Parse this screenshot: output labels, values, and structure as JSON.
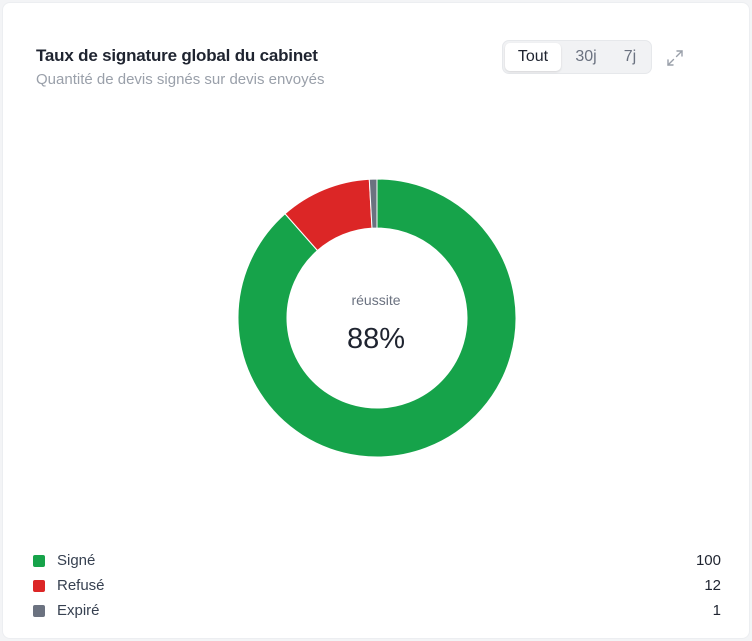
{
  "header": {
    "title": "Taux de signature global du cabinet",
    "subtitle": "Quantité de devis signés sur devis envoyés"
  },
  "filters": {
    "options": [
      "Tout",
      "30j",
      "7j"
    ],
    "selected": "Tout"
  },
  "icons": {
    "expand": "expand-icon"
  },
  "center": {
    "label": "réussite",
    "value": "88%"
  },
  "chart_data": {
    "type": "pie",
    "donut": true,
    "categories": [
      "Signé",
      "Refusé",
      "Expiré"
    ],
    "values": [
      100,
      12,
      1
    ],
    "colors": [
      "#16a34a",
      "#dc2626",
      "#6b7280"
    ]
  },
  "legend": [
    {
      "label": "Signé",
      "value": "100",
      "color": "#16a34a"
    },
    {
      "label": "Refusé",
      "value": "12",
      "color": "#dc2626"
    },
    {
      "label": "Expiré",
      "value": "1",
      "color": "#6b7280"
    }
  ]
}
